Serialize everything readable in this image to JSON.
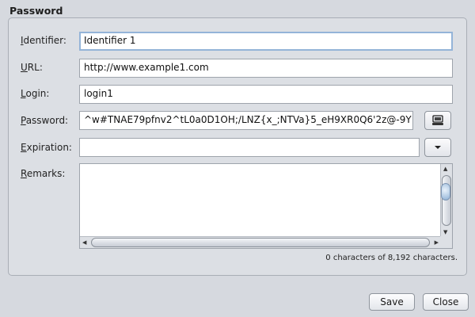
{
  "window": {
    "title": "Password"
  },
  "form": {
    "identifier": {
      "label": "Identifier:",
      "mnemonic": "I",
      "rest": "dentifier:",
      "value": "Identifier 1"
    },
    "url": {
      "label": "URL:",
      "mnemonic": "U",
      "rest": "RL:",
      "value": "http://www.example1.com"
    },
    "login": {
      "label": "Login:",
      "mnemonic": "L",
      "rest": "ogin:",
      "value": "login1"
    },
    "password": {
      "label": "Password:",
      "mnemonic": "P",
      "rest": "assword:",
      "value": "^w#TNAE79pfnv2^tL0a0D1OH;/LNZ{x_;NTVa}5_eH9XR0Q6'2z@-9Y",
      "button_icon": "keyboard-icon"
    },
    "expiration": {
      "label": "Expiration:",
      "mnemonic": "E",
      "rest": "xpiration:",
      "value": "",
      "button_icon": "chevron-down-icon"
    },
    "remarks": {
      "label": "Remarks:",
      "mnemonic": "R",
      "rest": "emarks:",
      "value": ""
    }
  },
  "char_count": "0 characters of 8,192 characters.",
  "buttons": {
    "save": "Save",
    "close": "Close"
  }
}
